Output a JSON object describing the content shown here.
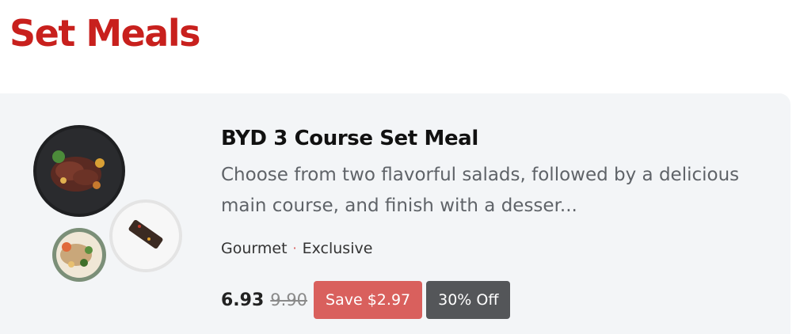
{
  "colors": {
    "brand": "#c8201d",
    "accent": "#d9534f",
    "save_badge": "#d9605d",
    "off_badge": "#545659"
  },
  "section": {
    "title": "Set Meals"
  },
  "product": {
    "name": "BYD 3 Course Set Meal",
    "description": "Choose from two flavorful salads, followed by a delicious main course, and finish with a desser...",
    "tags": [
      "Gourmet",
      "Exclusive"
    ],
    "tag_separator": "·",
    "price_current": "6.93",
    "price_original": "9.90",
    "save_badge": "Save $2.97",
    "discount_badge": "30% Off",
    "image_icon": "set-meal-plates-image"
  }
}
